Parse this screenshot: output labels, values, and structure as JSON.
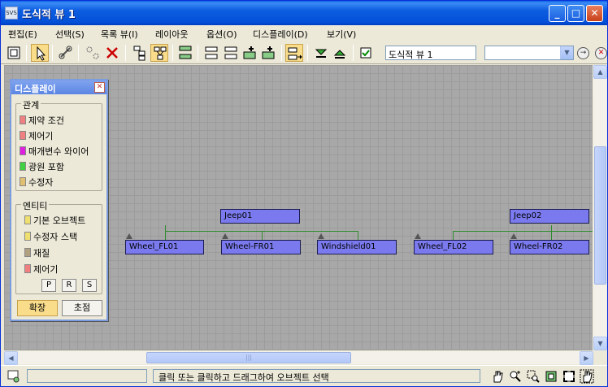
{
  "window": {
    "title": "도식적 뷰 1",
    "app_icon_text": "SVS"
  },
  "menu": [
    {
      "label": "편집(E)"
    },
    {
      "label": "선택(S)"
    },
    {
      "label": "목록 뷰(I)"
    },
    {
      "label": "레이아웃"
    },
    {
      "label": "옵션(O)"
    },
    {
      "label": "디스플레이(D)"
    },
    {
      "label": "보기(V)"
    }
  ],
  "toolbar": {
    "name_field": "도식적 뷰 1",
    "combo_value": "",
    "icons": [
      "display-floater-icon",
      "select-icon",
      "connect-icon",
      "unlink-selected-icon",
      "delete-icon",
      "hierarchy-mode-icon",
      "references-mode-icon",
      "always-arrange-icon",
      "collapse-selected-icon",
      "expand-selected-icon",
      "add-modifier-icon",
      "add-controller-icon",
      "arrange-children-icon",
      "hide-selected-icon",
      "unhide-all-icon",
      "sync-selection-icon",
      "previous-view-icon",
      "close-view-icon"
    ]
  },
  "graph": {
    "parents": [
      {
        "label": "Jeep01"
      },
      {
        "label": "Jeep02"
      }
    ],
    "children": [
      {
        "label": "Wheel_FL01"
      },
      {
        "label": "Wheel-FR01"
      },
      {
        "label": "Windshield01"
      },
      {
        "label": "Wheel_FL02"
      },
      {
        "label": "Wheel-FR02"
      }
    ],
    "colors": {
      "node": "#7a7aee",
      "wire": "#2e8b2e",
      "grid": "#a8a8a8"
    }
  },
  "display_panel": {
    "title": "디스플레이",
    "relations": {
      "legend": "관계",
      "items": [
        {
          "label": "제약 조건",
          "color": "#f08080"
        },
        {
          "label": "제어기",
          "color": "#f08080"
        },
        {
          "label": "매개변수 와이어",
          "color": "#e020e0"
        },
        {
          "label": "광원 포함",
          "color": "#40d040"
        },
        {
          "label": "수정자",
          "color": "#e0c070"
        }
      ]
    },
    "entities": {
      "legend": "엔티티",
      "items": [
        {
          "label": "기본 오브젝트",
          "color": "#f0e070"
        },
        {
          "label": "수정자 스택",
          "color": "#f0e070"
        },
        {
          "label": "재질",
          "color": "#b0a080"
        },
        {
          "label": "제어기",
          "color": "#f08080"
        }
      ],
      "prs": [
        "P",
        "R",
        "S"
      ]
    },
    "buttons": {
      "expand": "확장",
      "focus": "초점"
    }
  },
  "status": {
    "message": "클릭 또는 클릭하고 드래그하여 오브젝트 선택",
    "field_value": ""
  }
}
